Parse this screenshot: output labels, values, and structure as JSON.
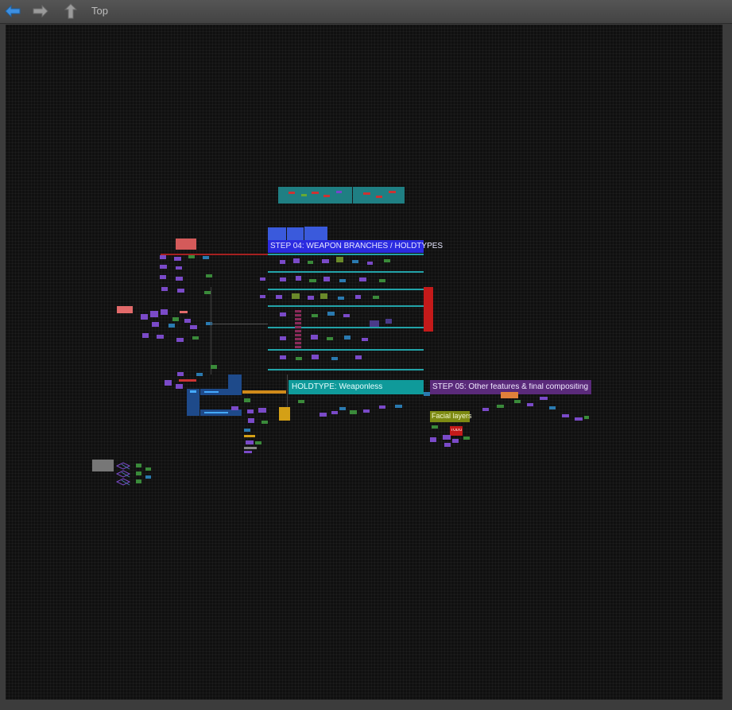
{
  "toolbar": {
    "back_icon": "back-arrow-icon",
    "forward_icon": "forward-arrow-icon",
    "up_icon": "up-arrow-icon",
    "breadcrumb": "Top"
  },
  "graph": {
    "step04_label": "STEP 04: WEAPON BRANCHES / HOLDTYPES",
    "holdtype_label": "HOLDTYPE: Weaponless",
    "step05_label": "STEP 05: Other features & final compositing",
    "facial_label": "Facial layers",
    "todo_label": "TODO"
  },
  "colors": {
    "step04": "#2b2be0",
    "holdtype": "#0f9a9a",
    "step05": "#5a2a7a",
    "facial": "#7d8a12",
    "todo": "#c41a1a"
  }
}
